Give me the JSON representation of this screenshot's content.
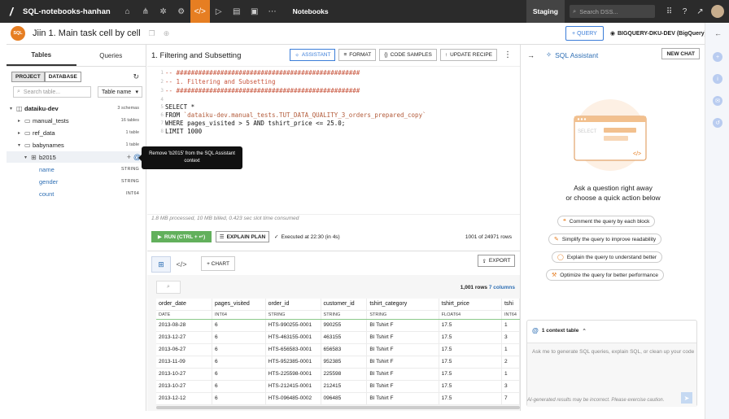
{
  "topbar": {
    "project": "SQL-notebooks-hanhan",
    "section": "Notebooks",
    "env": "Staging",
    "search_placeholder": "Search DSS..."
  },
  "header": {
    "badge": "SQL",
    "title": "Jiin 1. Main task cell by cell",
    "query_button": "+ QUERY",
    "connection": "BIGQUERY-DKU-DEV (BigQuery)"
  },
  "sidebar": {
    "tabs": [
      "Tables",
      "Queries"
    ],
    "scope": [
      "PROJECT",
      "DATABASE"
    ],
    "search_placeholder": "Search table...",
    "sort": "Table name",
    "tree": [
      {
        "label": "dataiku-dev",
        "count": "3 schemas"
      },
      {
        "label": "manual_tests",
        "count": "16 tables"
      },
      {
        "label": "ref_data",
        "count": "1 table"
      },
      {
        "label": "babynames",
        "count": "1 table"
      },
      {
        "label": "b2015",
        "count": ""
      }
    ],
    "fields": [
      {
        "name": "name",
        "type": "STRING"
      },
      {
        "name": "gender",
        "type": "STRING"
      },
      {
        "name": "count",
        "type": "INT64"
      }
    ],
    "tooltip": "Remove 'b2015' from the SQL Assistant context"
  },
  "cell": {
    "title": "1. Filtering and Subsetting",
    "buttons": [
      "ASSISTANT",
      "FORMAT",
      "CODE SAMPLES",
      "UPDATE RECIPE"
    ],
    "code": {
      "l1": "-- ##################################################",
      "l2": "-- 1. Filtering and Subsetting",
      "l3": "-- ##################################################",
      "l4": "",
      "l5a": "SELECT *",
      "l6a": "FROM ",
      "l6b": "`dataiku-dev.manual_tests.TUT_DATA_QUALITY_3_orders_prepared_copy`",
      "l7a": "WHERE pages_visited > 5 AND tshirt_price <= 25.0;",
      "l8a": "LIMIT 1000"
    },
    "meta": "1.8 MB processed, 10 MB billed, 0.423 sec slot time consumed",
    "run": "RUN (CTRL + ↵)",
    "explain": "EXPLAIN PLAN",
    "executed": "Executed at 22:30 (in 4s)",
    "rows": "1001 of 24971 rows"
  },
  "results": {
    "chart_label": "+ CHART",
    "export_label": "EXPORT",
    "row_count": "1,001 rows",
    "col_count": "7 columns",
    "columns": [
      {
        "name": "order_date",
        "type": "DATE"
      },
      {
        "name": "pages_visited",
        "type": "INT64"
      },
      {
        "name": "order_id",
        "type": "STRING"
      },
      {
        "name": "customer_id",
        "type": "STRING"
      },
      {
        "name": "tshirt_category",
        "type": "STRING"
      },
      {
        "name": "tshirt_price",
        "type": "FLOAT64"
      },
      {
        "name": "tshi",
        "type": "INT64"
      }
    ],
    "rows": [
      [
        "2013-08-28",
        "6",
        "HTS-990255-0001",
        "990255",
        "BI Tshirt F",
        "17.5",
        "1"
      ],
      [
        "2013-12-27",
        "6",
        "HTS-463155-0001",
        "463155",
        "BI Tshirt F",
        "17.5",
        "3"
      ],
      [
        "2013-06-27",
        "6",
        "HTS-656583-0001",
        "656583",
        "BI Tshirt F",
        "17.5",
        "1"
      ],
      [
        "2013-11-09",
        "6",
        "HTS-952385-0001",
        "952385",
        "BI Tshirt F",
        "17.5",
        "2"
      ],
      [
        "2013-10-27",
        "6",
        "HTS-225598-0001",
        "225598",
        "BI Tshirt F",
        "17.5",
        "1"
      ],
      [
        "2013-10-27",
        "6",
        "HTS-212415-0001",
        "212415",
        "BI Tshirt F",
        "17.5",
        "3"
      ],
      [
        "2013-12-12",
        "6",
        "HTS-096485-0002",
        "096485",
        "BI Tshirt F",
        "17.5",
        "7"
      ]
    ]
  },
  "assistant": {
    "title": "SQL Assistant",
    "new_chat": "NEW CHAT",
    "illus_text": "SELECT",
    "prompt1": "Ask a question right away",
    "prompt2": "or choose a quick action below",
    "actions": [
      "Comment the query by each block",
      "Simplify the query to improve readability",
      "Explain the query to understand better",
      "Optimize the query for better performance"
    ],
    "context": "1 context table",
    "input_placeholder": "Ask me to generate SQL queries, explain SQL, or clean up your code",
    "disclaimer": "AI-generated results may be incorrect. Please exercise caution."
  }
}
